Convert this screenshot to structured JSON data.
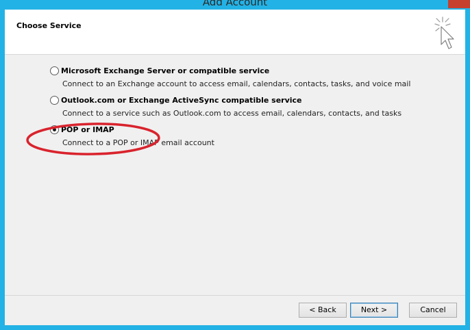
{
  "window": {
    "title": "Add Account"
  },
  "header": {
    "title": "Choose Service",
    "icon": "cursor-sparkle-icon"
  },
  "options": [
    {
      "title": "Microsoft Exchange Server or compatible service",
      "description": "Connect to an Exchange account to access email, calendars, contacts, tasks, and voice mail",
      "checked": false
    },
    {
      "title": "Outlook.com or Exchange ActiveSync compatible service",
      "description": "Connect to a service such as Outlook.com to access email, calendars, contacts, and tasks",
      "checked": false
    },
    {
      "title": "POP or IMAP",
      "description": "Connect to a POP or IMAP email account",
      "checked": true
    }
  ],
  "annotation": {
    "shape": "ellipse",
    "color": "#d9232d"
  },
  "buttons": {
    "back": "< Back",
    "next": "Next >",
    "cancel": "Cancel"
  },
  "colors": {
    "titlebar": "#23b2e5",
    "close": "#c7402e"
  }
}
